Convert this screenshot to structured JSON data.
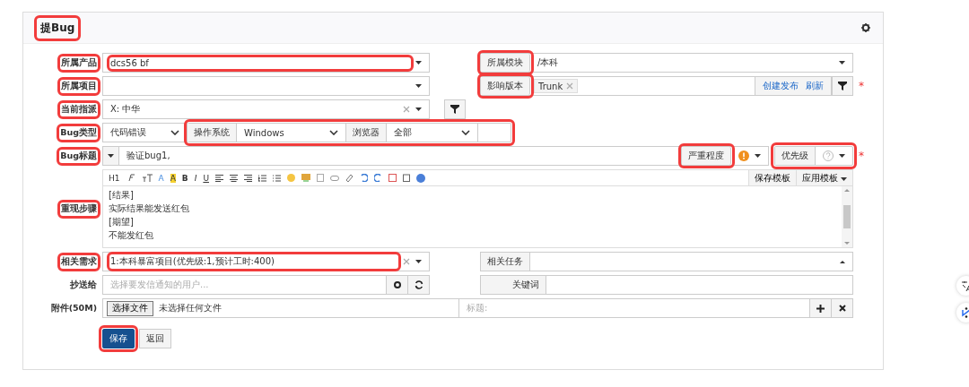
{
  "form": {
    "title": "提Bug",
    "highlighted": true
  },
  "product": {
    "label": "所属产品",
    "value": "dcs56 bf",
    "highlighted": true
  },
  "module": {
    "label": "所属模块",
    "value": "/本科",
    "highlighted": true
  },
  "project": {
    "label": "所属项目",
    "highlighted": true
  },
  "build": {
    "label": "影响版本",
    "tags": [
      "Trunk"
    ],
    "links": [
      "创建发布",
      "刷新"
    ],
    "highlighted": true,
    "required_mark": "*"
  },
  "assigned": {
    "label": "当前指派",
    "value": "X: 中华",
    "highlighted": true
  },
  "type": {
    "label": "Bug类型",
    "value": "代码错误",
    "highlighted": true
  },
  "environment": {
    "highlighted": true,
    "os": {
      "label": "操作系统",
      "value": "Windows"
    },
    "browser": {
      "label": "浏览器",
      "value": "全部"
    }
  },
  "bug_title": {
    "label": "Bug标题",
    "value": "验证bug1,",
    "highlighted": true
  },
  "severity": {
    "label": "严重程度",
    "highlighted": true
  },
  "priority": {
    "label": "优先级",
    "highlighted": true,
    "required_mark": "*"
  },
  "toolbar": {
    "heading": "H1",
    "font_color": "A",
    "highlight": "A",
    "bold": "B",
    "italic": "I",
    "underline": "U"
  },
  "steps": {
    "label": "重现步骤",
    "highlighted": true,
    "lines": [
      "[结果]",
      "实际结果能发送红包",
      "[期望]",
      "不能发红包"
    ],
    "template_buttons": [
      "保存模板",
      "应用模板"
    ]
  },
  "story": {
    "label": "相关需求",
    "value": "1:本科暴富项目(优先级:1,预计工时:400)",
    "highlighted": true
  },
  "task": {
    "label": "相关任务"
  },
  "mailto": {
    "label": "抄送给",
    "placeholder": "选择要发信通知的用户..."
  },
  "keywords": {
    "label": "关键词"
  },
  "files": {
    "label": "附件(50M)",
    "button": "选择文件",
    "status": "未选择任何文件",
    "title_placeholder": "标题:"
  },
  "actions": [
    {
      "label": "保存",
      "kind": "primary",
      "highlighted": true
    },
    {
      "label": "返回",
      "kind": "default",
      "highlighted": false
    }
  ]
}
